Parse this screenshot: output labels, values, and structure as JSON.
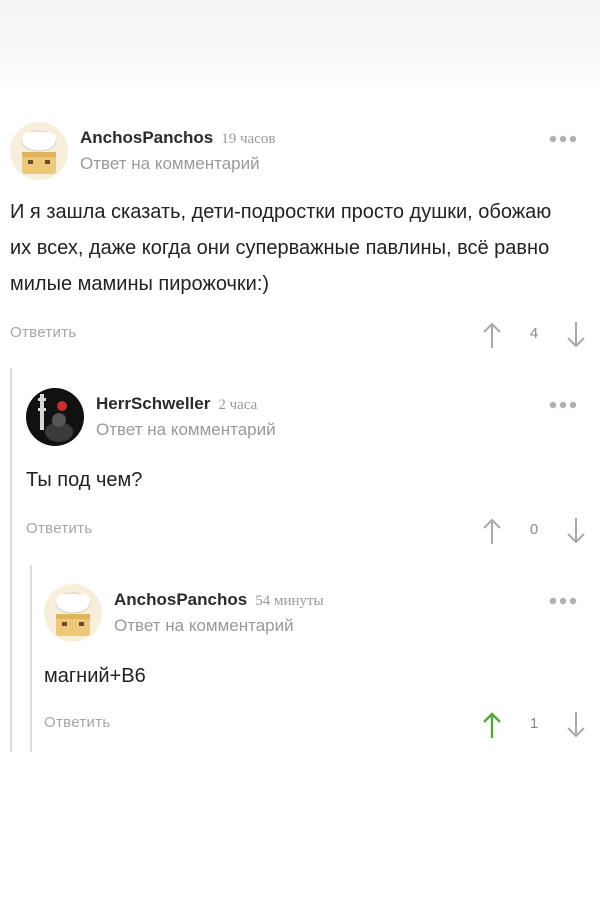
{
  "comments": [
    {
      "author": "AnchosPanchos",
      "time": "19 часов",
      "subtitle": "Ответ на комментарий",
      "text": "И я зашла сказать, дети-подростки просто душки, обожаю их всех, даже когда они суперважные павлины, всё равно милые мамины пирожочки:)",
      "reply_label": "Ответить",
      "score": "4",
      "avatar_icon": "chef-cake-avatar",
      "upvote_color": "#a8a8a8"
    },
    {
      "author": "HerrSchweller",
      "time": "2 часа",
      "subtitle": "Ответ на комментарий",
      "text": "Ты под чем?",
      "reply_label": "Ответить",
      "score": "0",
      "avatar_icon": "dark-figure-avatar",
      "upvote_color": "#a8a8a8"
    },
    {
      "author": "AnchosPanchos",
      "time": "54 минуты",
      "subtitle": "Ответ на комментарий",
      "text": "магний+B6",
      "reply_label": "Ответить",
      "score": "1",
      "avatar_icon": "chef-cake-avatar",
      "upvote_color": "#52a83a"
    }
  ],
  "colors": {
    "author": "#2b2b2b",
    "muted": "#999999",
    "thread_line": "#dcdcdc",
    "upvoted": "#52a83a"
  }
}
